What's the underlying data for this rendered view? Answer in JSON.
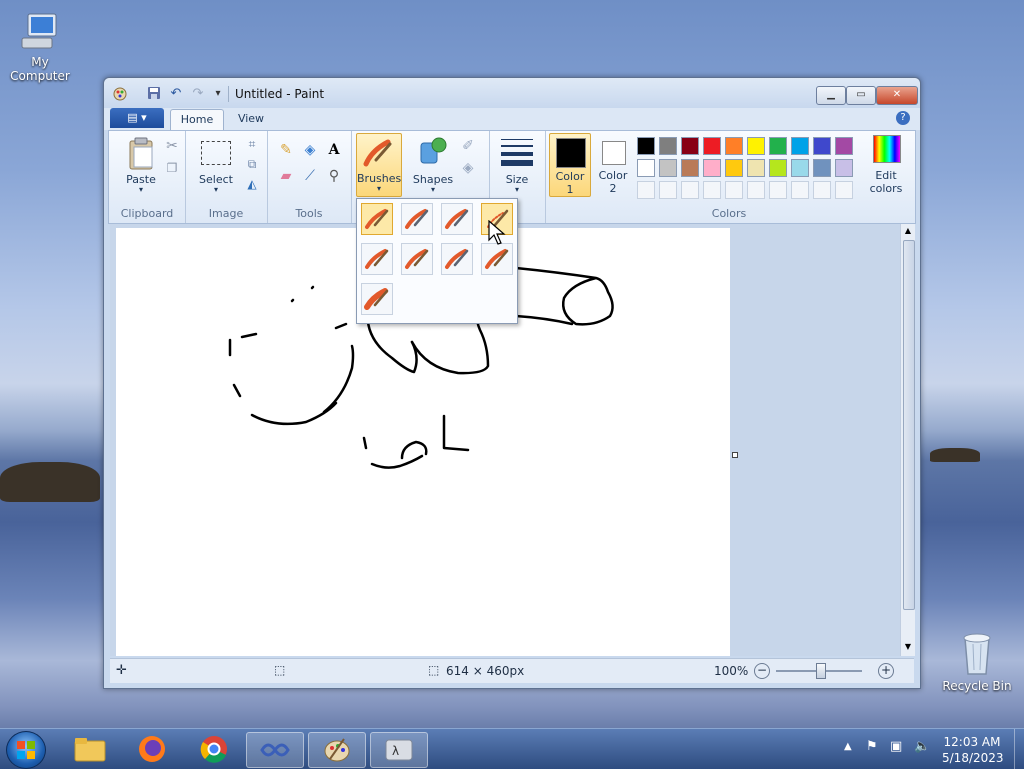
{
  "desktop": {
    "icons": [
      {
        "label": "My Computer"
      },
      {
        "label": "Recycle Bin"
      }
    ]
  },
  "window": {
    "title": "Untitled - Paint",
    "tabs": [
      {
        "label": "Home"
      },
      {
        "label": "View"
      }
    ],
    "ribbon": {
      "clipboard": {
        "label": "Clipboard",
        "paste": "Paste"
      },
      "image": {
        "label": "Image",
        "select": "Select"
      },
      "tools": {
        "label": "Tools"
      },
      "brushes": "Brushes",
      "shapes": "Shapes",
      "size": "Size",
      "color1": "Color\n1",
      "color1_a": "Color",
      "color1_b": "1",
      "color2_a": "Color",
      "color2_b": "2",
      "colors": {
        "label": "Colors",
        "edit": "Edit\ncolors",
        "edit_a": "Edit",
        "edit_b": "colors"
      }
    },
    "palette": {
      "row1": [
        "#000000",
        "#7f7f7f",
        "#880015",
        "#ed1c24",
        "#ff7f27",
        "#fff200",
        "#22b14c",
        "#00a2e8",
        "#3f48cc",
        "#a349a4"
      ],
      "row2": [
        "#ffffff",
        "#c3c3c3",
        "#b97a57",
        "#ffaec9",
        "#ffc90e",
        "#efe4b0",
        "#b5e61d",
        "#99d9ea",
        "#7092be",
        "#c8bfe7"
      ],
      "color1": "#000000",
      "color2": "#ffffff"
    },
    "status": {
      "dimensions": "614 × 460px",
      "zoom": "100%"
    }
  },
  "taskbar": {
    "time": "12:03 AM",
    "date": "5/18/2023"
  }
}
